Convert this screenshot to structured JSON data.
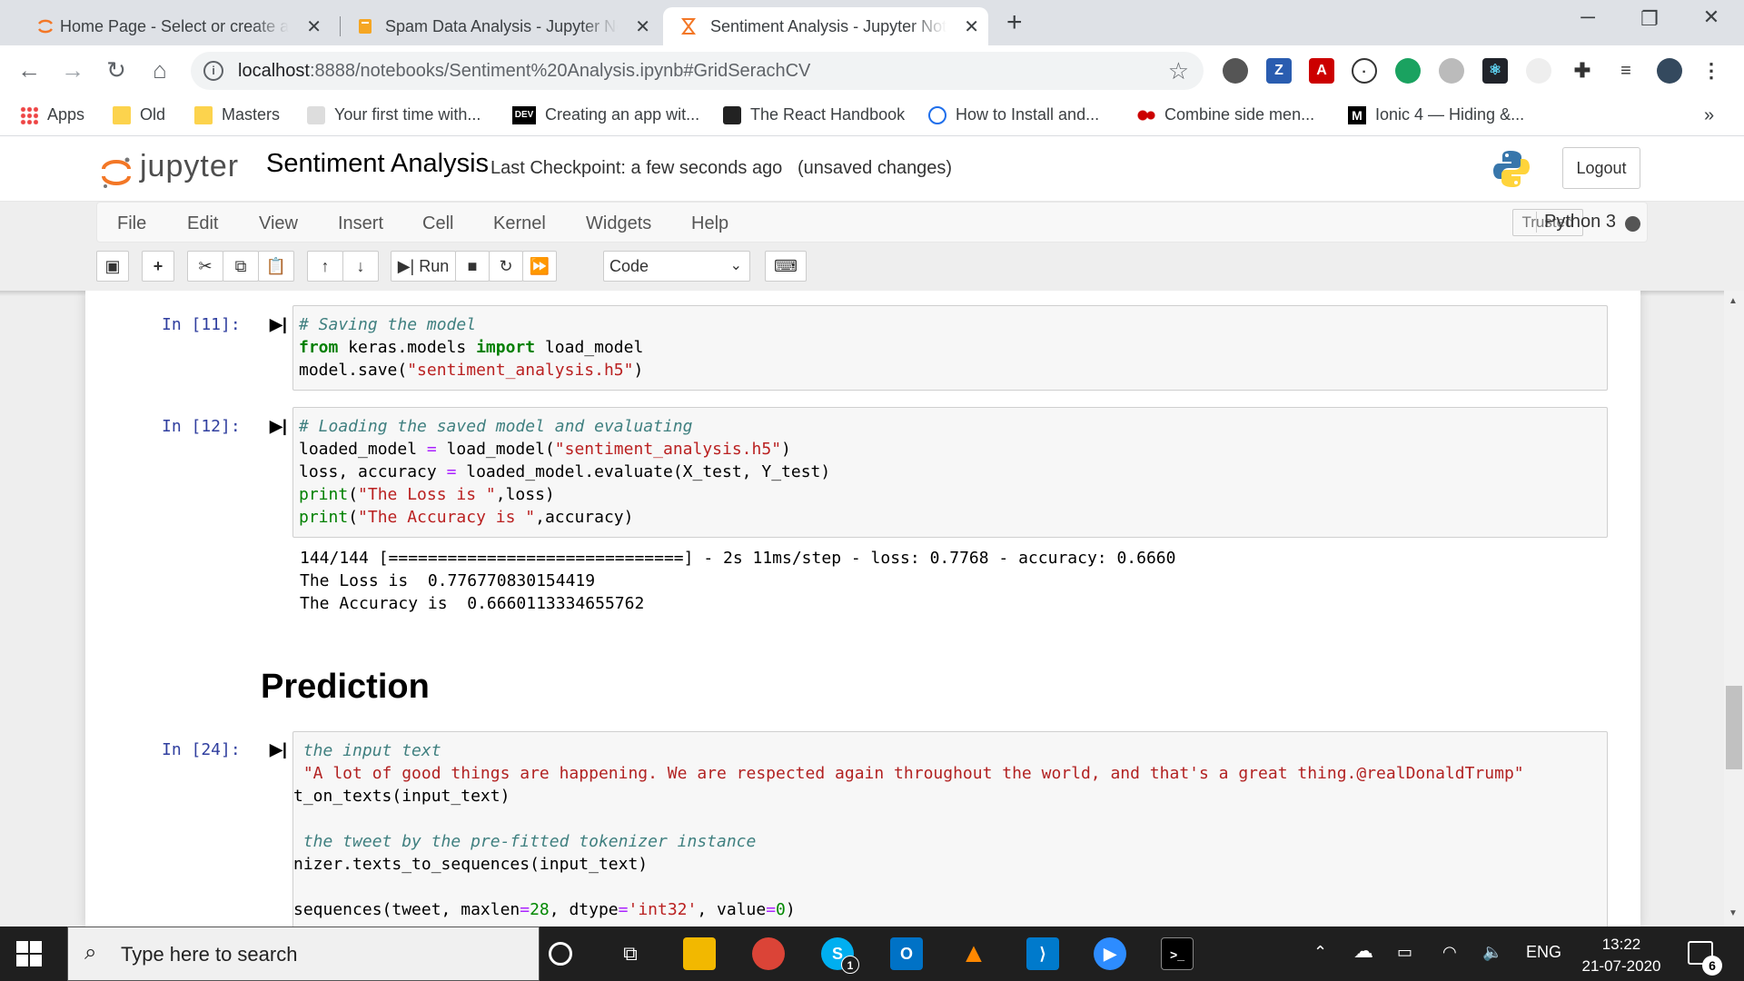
{
  "browser": {
    "tabs": [
      {
        "title": "Home Page - Select or create a notebook",
        "icon": "jupyter-icon"
      },
      {
        "title": "Spam Data Analysis - Jupyter Notebook",
        "icon": "notebook-icon"
      },
      {
        "title": "Sentiment Analysis - Jupyter Notebook",
        "icon": "hourglass-icon"
      }
    ],
    "url_host": "localhost",
    "url_path": ":8888/notebooks/Sentiment%20Analysis.ipynb#GridSerachCV",
    "extensions": [
      "Z"
    ],
    "bookmarks": [
      {
        "label": "Apps"
      },
      {
        "label": "Old"
      },
      {
        "label": "Masters"
      },
      {
        "label": "Your first time with..."
      },
      {
        "label": "Creating an app wit..."
      },
      {
        "label": "The React Handbook"
      },
      {
        "label": "How to Install and..."
      },
      {
        "label": "Combine side men..."
      },
      {
        "label": "Ionic 4 — Hiding &..."
      }
    ],
    "bookmarks_more": "»"
  },
  "jupyter": {
    "logo_text": "jupyter",
    "notebook_title": "Sentiment Analysis",
    "checkpoint": "Last Checkpoint: a few seconds ago",
    "save_status": "(unsaved changes)",
    "logout": "Logout",
    "menus": [
      "File",
      "Edit",
      "View",
      "Insert",
      "Cell",
      "Kernel",
      "Widgets",
      "Help"
    ],
    "trusted": "Trusted",
    "kernel_name": "Python 3",
    "run_label": "Run",
    "cell_type": "Code"
  },
  "cells": {
    "c11": {
      "prompt": "In [11]:"
    },
    "c12": {
      "prompt": "In [12]:",
      "output": [
        "144/144 [==============================] - 2s 11ms/step - loss: 0.7768 - accuracy: 0.6660",
        "The Loss is  0.776770830154419",
        "The Accuracy is  0.6660113334655762"
      ]
    },
    "markdown_heading": "Prediction",
    "c24": {
      "prompt": "In [24]:"
    }
  },
  "taskbar": {
    "search_placeholder": "Type here to search",
    "language": "ENG",
    "time": "13:22",
    "date": "21-07-2020",
    "notification_count": "6",
    "skype_badge": "1"
  },
  "colors": {
    "jupyter_orange": "#f37726",
    "prompt_blue": "#303f9f",
    "taskbar_bg": "#1f1f1f"
  }
}
